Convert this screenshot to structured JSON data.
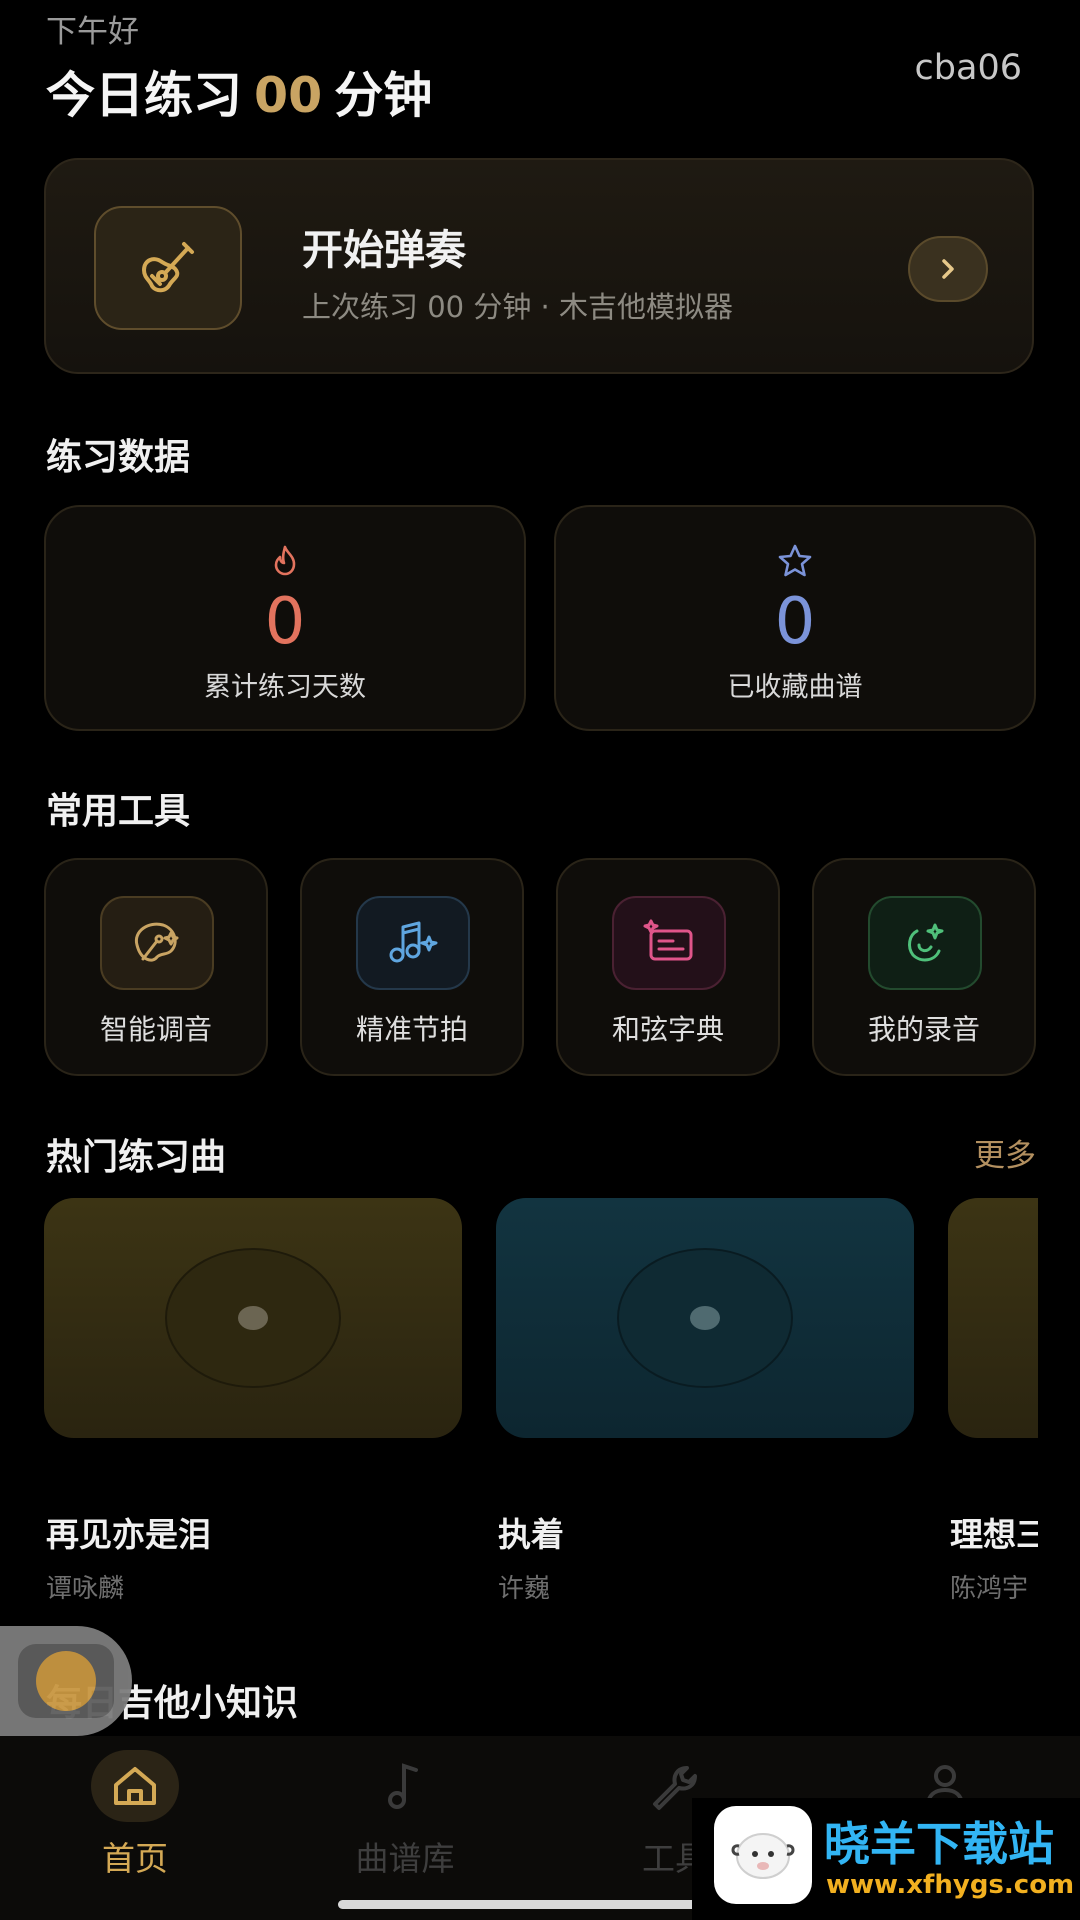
{
  "header": {
    "greeting": "下午好",
    "today_prefix": "今日练习",
    "today_minutes": "00",
    "today_suffix": "分钟",
    "username": "cba06"
  },
  "start_card": {
    "title": "开始弹奏",
    "subtitle": "上次练习 00 分钟 · 木吉他模拟器",
    "icon": "guitar-icon",
    "arrow_icon": "chevron-right-icon"
  },
  "stats": {
    "section_title": "练习数据",
    "items": [
      {
        "icon": "flame-icon",
        "value": "0",
        "label": "累计练习天数",
        "color": "#e2735e"
      },
      {
        "icon": "star-icon",
        "value": "0",
        "label": "已收藏曲谱",
        "color": "#7b93d9"
      }
    ]
  },
  "tools": {
    "section_title": "常用工具",
    "items": [
      {
        "label": "智能调音",
        "icon": "tuner-icon",
        "color": "#c9a463"
      },
      {
        "label": "精准节拍",
        "icon": "metronome-icon",
        "color": "#5fa6e0"
      },
      {
        "label": "和弦字典",
        "icon": "chord-dictionary-icon",
        "color": "#e0558a"
      },
      {
        "label": "我的录音",
        "icon": "recording-icon",
        "color": "#4fc07a"
      }
    ]
  },
  "songs": {
    "section_title": "热门练习曲",
    "more_label": "更多",
    "items": [
      {
        "title": "再见亦是泪",
        "artist": "谭咏麟"
      },
      {
        "title": "执着",
        "artist": "许巍"
      },
      {
        "title": "理想三",
        "artist": "陈鸿宇"
      }
    ]
  },
  "tips": {
    "section_title": "每日吉他小知识"
  },
  "bottom_nav": {
    "items": [
      {
        "label": "首页",
        "icon": "home-icon",
        "active": true
      },
      {
        "label": "曲谱库",
        "icon": "music-note-icon",
        "active": false
      },
      {
        "label": "工具",
        "icon": "wrench-icon",
        "active": false
      },
      {
        "label": "我的",
        "icon": "person-icon",
        "active": false
      }
    ]
  },
  "watermark": {
    "title": "晓羊下载站",
    "url": "www.xfhygs.com"
  },
  "colors": {
    "accent": "#c9a463",
    "background": "#000000"
  }
}
